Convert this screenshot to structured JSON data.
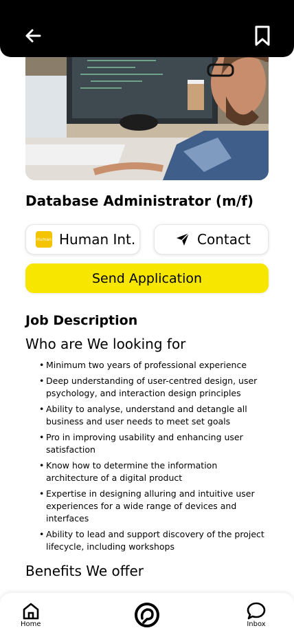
{
  "header": {
    "back_icon": "arrow-left-icon",
    "bookmark_icon": "bookmark-icon"
  },
  "job": {
    "title": "Database Administrator (m/f)",
    "company": "Human Int.",
    "company_logo_text": "Human",
    "contact_label": "Contact",
    "send_label": "Send Application",
    "section_title": "Job Description",
    "looking_for_title": "Who are We looking for",
    "requirements": [
      "Minimum two years of professional experience",
      "Deep understanding of user-centred design, user psychology, and interaction design principles",
      "Ability to analyse, understand and detangle all business and user needs to meet set goals",
      "Pro in improving usability and enhancing user satisfaction",
      "Know how to determine the information architecture of a digital product",
      "Expertise in designing alluring and intuitive user experiences for a wide range of devices and interfaces",
      "Ability to lead and support discovery of the project lifecycle, including workshops"
    ],
    "benefits_title": "Benefits We offer"
  },
  "nav": {
    "home_label": "Home",
    "inbox_label": "Inbox"
  },
  "colors": {
    "accent": "#f7e600",
    "topbar": "#000000"
  }
}
